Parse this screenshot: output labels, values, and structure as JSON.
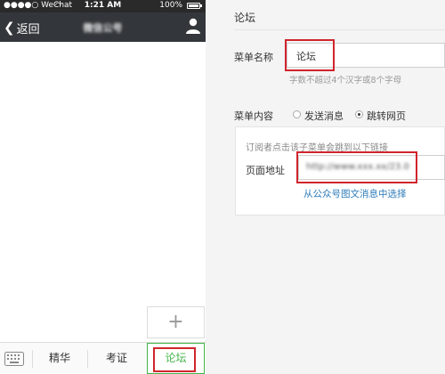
{
  "status_bar": {
    "carrier": "●●●●○ WeChat",
    "time": "1:21 AM",
    "battery": "100%",
    "icons": [
      "wifi-icon",
      "battery-icon"
    ]
  },
  "nav_bar": {
    "back_label": "返回",
    "account_name": "微信公号",
    "icons": [
      "chevron-left-icon",
      "person-icon"
    ]
  },
  "add_submenu_icon": "plus-icon",
  "bottom_menu": {
    "keyboard_icon": "keyboard-icon",
    "tabs": [
      {
        "label": "精华"
      },
      {
        "label": "考证"
      },
      {
        "label": "论坛",
        "active": true
      }
    ]
  },
  "editor": {
    "header": "论坛",
    "menu_name": {
      "label": "菜单名称",
      "value": "论坛",
      "hint": "字数不超过4个汉字或8个字母"
    },
    "menu_content": {
      "label": "菜单内容",
      "options": [
        {
          "label": "发送消息",
          "selected": false
        },
        {
          "label": "跳转网页",
          "selected": true
        }
      ]
    },
    "url_section": {
      "notice": "订阅者点击该子菜单会跳到以下链接",
      "label": "页面地址",
      "value": "http://www.xxx.xx/23.0",
      "pick_link": "从公众号图文消息中选择"
    }
  },
  "colors": {
    "accent_green": "#44b549",
    "highlight_red": "#d0252d",
    "link_blue": "#2a7ab8",
    "nav_dark": "#33363a"
  }
}
